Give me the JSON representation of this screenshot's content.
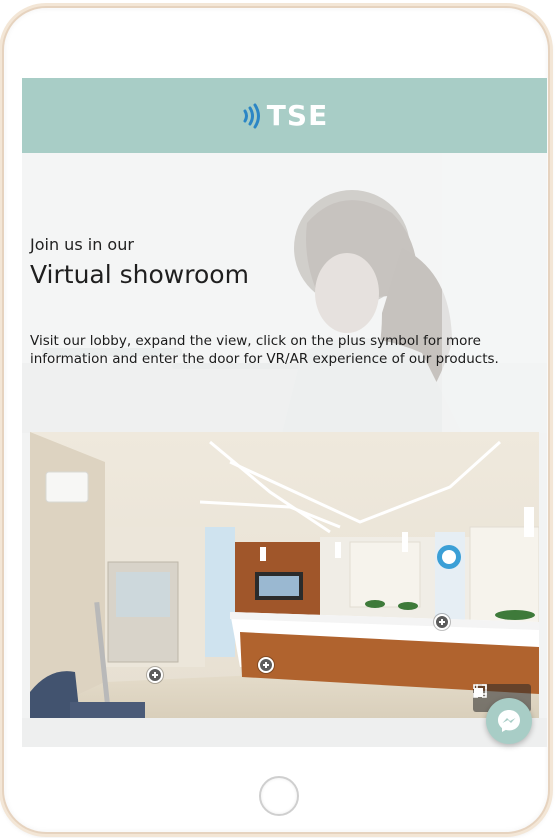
{
  "header": {
    "logo_text": "TSE",
    "logo_icon": "sound-waves-icon",
    "background_color": "#a8cdc6"
  },
  "hero": {
    "intro": "Join us in our",
    "title": "Virtual showroom",
    "description": "Visit our lobby, expand the view, click on the plus symbol for more information and enter the door for VR/AR experience of our products."
  },
  "tour": {
    "hotspot_icon": "plus-circle-icon",
    "controls": [
      {
        "name": "gallery-icon"
      },
      {
        "name": "fullscreen-icon"
      }
    ]
  },
  "chat": {
    "icon": "messenger-icon",
    "color": "#a8cdc6"
  }
}
